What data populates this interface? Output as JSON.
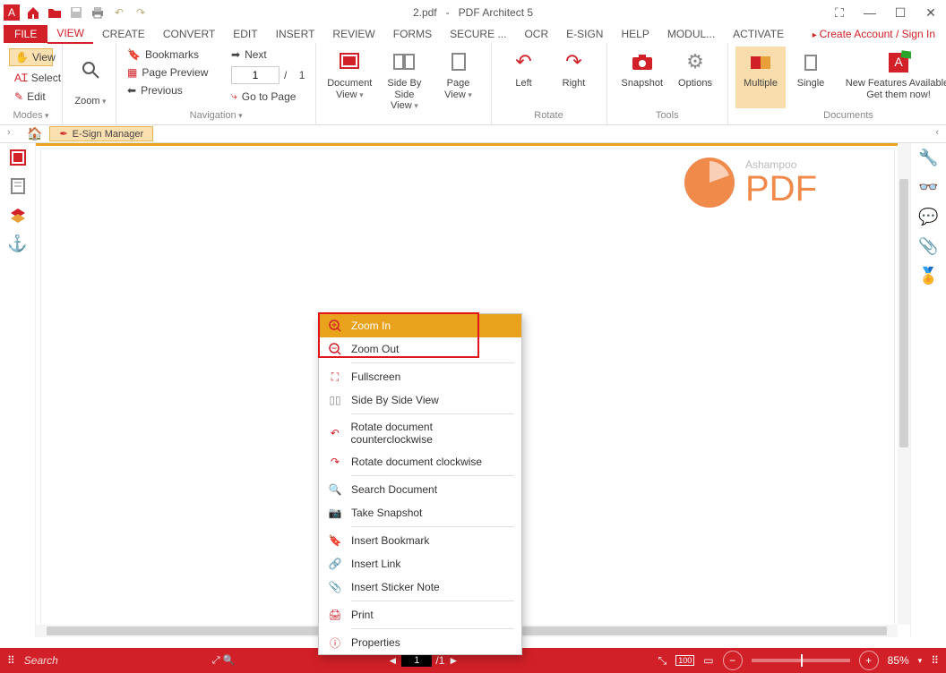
{
  "title": {
    "doc": "2.pdf",
    "sep": "-",
    "app": "PDF Architect 5"
  },
  "menubar": {
    "file": "FILE",
    "tabs": [
      "VIEW",
      "CREATE",
      "CONVERT",
      "EDIT",
      "INSERT",
      "REVIEW",
      "FORMS",
      "SECURE ...",
      "OCR",
      "E-SIGN",
      "HELP",
      "MODUL...",
      "ACTIVATE"
    ],
    "active": "VIEW",
    "account": "Create Account / Sign In"
  },
  "ribbon": {
    "modes": {
      "label": "Modes",
      "view": "View",
      "select": "Select",
      "edit": "Edit"
    },
    "zoom": {
      "label": "Zoom"
    },
    "nav": {
      "label": "Navigation",
      "bookmarks": "Bookmarks",
      "page_preview": "Page Preview",
      "previous": "Previous",
      "next": "Next",
      "page_value": "1",
      "page_sep": "/",
      "page_total": "1",
      "goto": "Go to Page"
    },
    "views": {
      "doc": "Document View",
      "sbs": "Side By Side View",
      "page": "Page View"
    },
    "rotate": {
      "label": "Rotate",
      "left": "Left",
      "right": "Right"
    },
    "tools": {
      "label": "Tools",
      "snapshot": "Snapshot",
      "options": "Options"
    },
    "docs": {
      "label": "Documents",
      "multiple": "Multiple",
      "single": "Single",
      "news1": "New Features Available.",
      "news2": "Get them now!"
    }
  },
  "subheader": {
    "esign": "E-Sign Manager"
  },
  "watermark": {
    "brand": "Ashampoo",
    "product": "PDF"
  },
  "ctx": {
    "zoom_in": "Zoom In",
    "zoom_out": "Zoom Out",
    "fullscreen": "Fullscreen",
    "sbs": "Side By Side View",
    "rccw": "Rotate document counterclockwise",
    "rcw": "Rotate document clockwise",
    "search": "Search Document",
    "snap": "Take Snapshot",
    "bookmark": "Insert Bookmark",
    "link": "Insert Link",
    "sticker": "Insert Sticker Note",
    "print": "Print",
    "props": "Properties"
  },
  "status": {
    "search_ph": "Search",
    "page_cur": "1",
    "page_sep": "/1",
    "zoom": "85%"
  }
}
